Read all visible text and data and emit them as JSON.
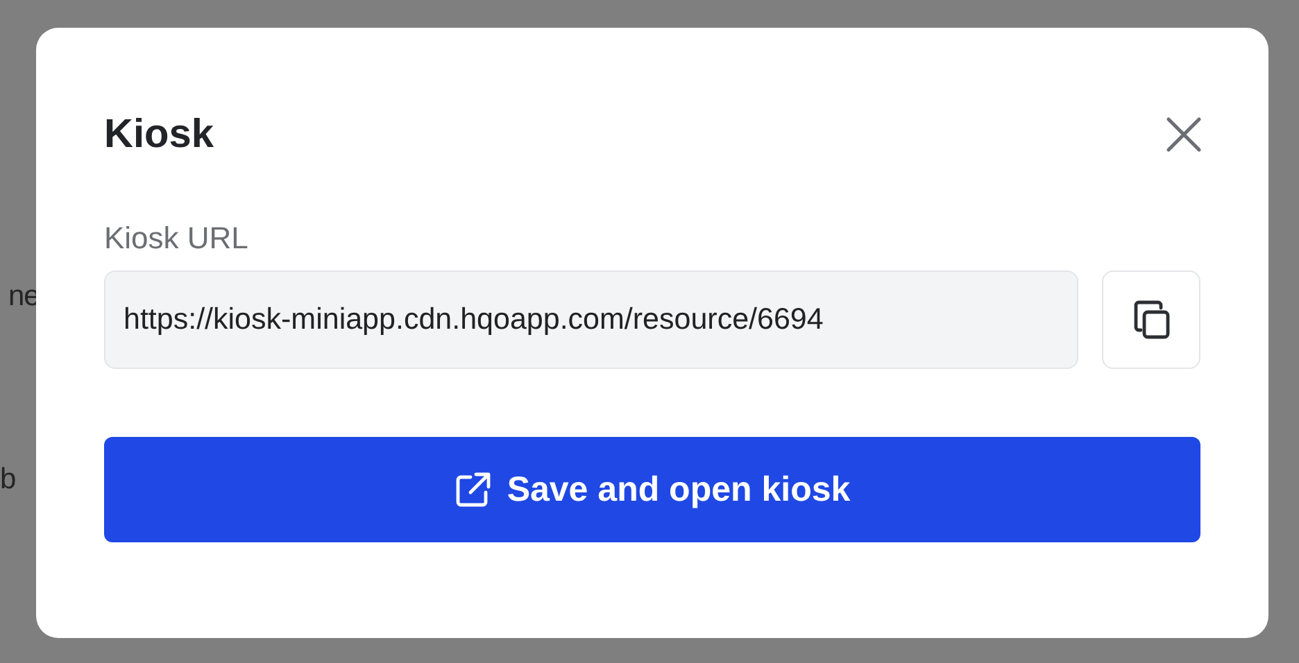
{
  "background": {
    "texts": [
      "ne",
      "b"
    ]
  },
  "dialog": {
    "title": "Kiosk",
    "field": {
      "label": "Kiosk URL",
      "value": "https://kiosk-miniapp.cdn.hqoapp.com/resource/6694"
    },
    "primary_button": {
      "label": "Save and open kiosk"
    }
  }
}
